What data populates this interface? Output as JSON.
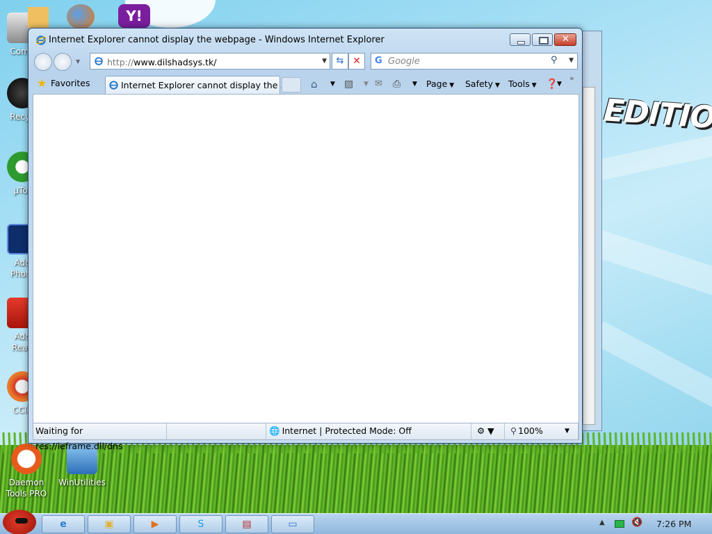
{
  "desktop": {
    "icons": [
      {
        "label": "Comp",
        "icon": "computer-icon"
      },
      {
        "label": "Recyc",
        "icon": "recycle-bin-icon"
      },
      {
        "label": "µTor",
        "icon": "utorrent-icon"
      },
      {
        "label": "Ado\nPhoto",
        "icon": "photoshop-icon"
      },
      {
        "label": "Ado\nRead",
        "icon": "acrobat-reader-icon"
      },
      {
        "label": "CCle",
        "icon": "ccleaner-icon"
      },
      {
        "label": "Daemon\nTools PRO",
        "icon": "daemon-tools-icon"
      },
      {
        "label": "WinUtilities",
        "icon": "winutilities-icon"
      }
    ],
    "top_icons": [
      "firefox-icon",
      "yahoo-messenger-icon",
      "folder-icon"
    ],
    "wallpaper_text": "EDITION"
  },
  "window": {
    "title": "Internet Explorer cannot display the webpage - Windows Internet Explorer",
    "buttons": {
      "minimize": "minimize",
      "maximize": "maximize",
      "close": "close"
    }
  },
  "address_bar": {
    "url_proto": "http://",
    "url_rest": "www.dilshadsys.tk/"
  },
  "search": {
    "provider": "G",
    "placeholder": "Google"
  },
  "command_bar": {
    "favorites_label": "Favorites",
    "tab_title": "Internet Explorer cannot display the ...",
    "page_label": "Page",
    "safety_label": "Safety",
    "tools_label": "Tools",
    "more": "»"
  },
  "status_bar": {
    "status_text": "Waiting for res://ieframe.dll/dns",
    "zone_text": "Internet | Protected Mode: Off",
    "zoom_text": "100%"
  },
  "taskbar": {
    "buttons": [
      "ie-icon",
      "explorer-icon",
      "media-player-icon",
      "skype-icon",
      "toolbox-icon",
      "screen-icon"
    ],
    "clock": "7:26 PM"
  },
  "colors": {
    "accent": "#2a6fc9",
    "close_button": "#c7402b",
    "wallpaper": "#a7dff3"
  }
}
